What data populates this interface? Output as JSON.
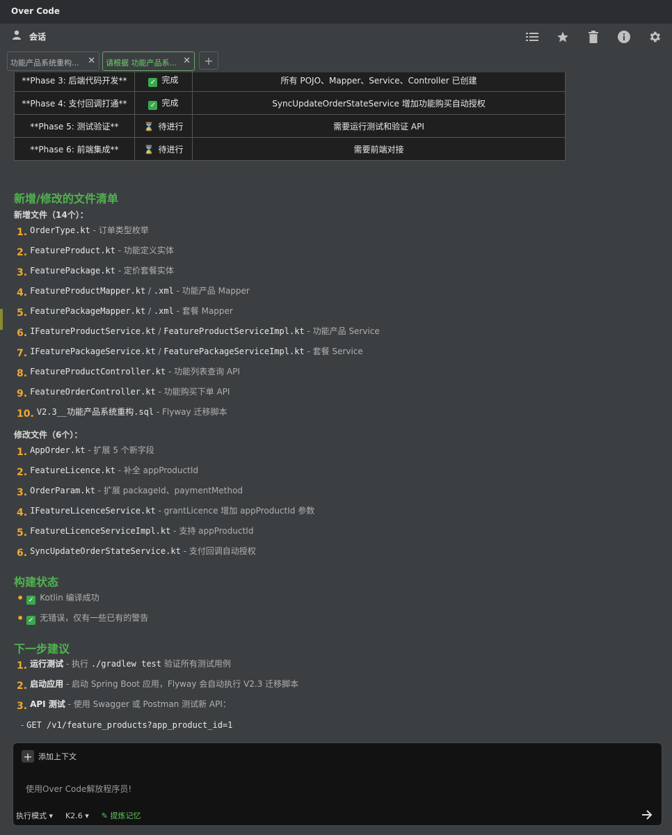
{
  "app": {
    "title": "Over Code"
  },
  "session": {
    "label": "会话"
  },
  "tabs": [
    {
      "label": "功能产品系统重构..."
    },
    {
      "label": "请根据 功能产品系..."
    }
  ],
  "phase_table": [
    {
      "phase": "**Phase 3: 后端代码开发**",
      "status": "完成",
      "status_icon": "check-icon",
      "note": "所有 POJO、Mapper、Service、Controller 已创建"
    },
    {
      "phase": "**Phase 4: 支付回调打通**",
      "status": "完成",
      "status_icon": "check-icon",
      "note": "SyncUpdateOrderStateService 增加功能购买自动授权"
    },
    {
      "phase": "**Phase 5: 测试验证**",
      "status": "待进行",
      "status_icon": "hourglass-icon",
      "note": "需要运行测试和验证 API"
    },
    {
      "phase": "**Phase 6: 前端集成**",
      "status": "待进行",
      "status_icon": "hourglass-icon",
      "note": "需要前端对接"
    }
  ],
  "files": {
    "heading": "新增/修改的文件清单",
    "new_heading": "新增文件（14个）：",
    "new_items": [
      {
        "num": "1.",
        "code": "OrderType.kt",
        "desc": " - 订单类型枚举"
      },
      {
        "num": "2.",
        "code": "FeatureProduct.kt",
        "desc": " - 功能定义实体"
      },
      {
        "num": "3.",
        "code": "FeaturePackage.kt",
        "desc": " - 定价套餐实体"
      },
      {
        "num": "4.",
        "code": "FeatureProductMapper.kt",
        "sep": " / ",
        "code2": ".xml",
        "desc": " - 功能产品 Mapper"
      },
      {
        "num": "5.",
        "code": "FeaturePackageMapper.kt",
        "sep": " / ",
        "code2": ".xml",
        "desc": " - 套餐 Mapper"
      },
      {
        "num": "6.",
        "code": "IFeatureProductService.kt",
        "sep": " / ",
        "code2": "FeatureProductServiceImpl.kt",
        "desc": " - 功能产品 Service"
      },
      {
        "num": "7.",
        "code": "IFeaturePackageService.kt",
        "sep": " / ",
        "code2": "FeaturePackageServiceImpl.kt",
        "desc": " - 套餐 Service"
      },
      {
        "num": "8.",
        "code": "FeatureProductController.kt",
        "desc": " - 功能列表查询 API"
      },
      {
        "num": "9.",
        "code": "FeatureOrderController.kt",
        "desc": " - 功能购买下单 API"
      },
      {
        "num": "10.",
        "code": "V2.3__功能产品系统重构.sql",
        "desc": " - Flyway 迁移脚本"
      }
    ],
    "mod_heading": "修改文件（6个）：",
    "mod_items": [
      {
        "num": "1.",
        "code": "AppOrder.kt",
        "desc": " - 扩展 5 个新字段"
      },
      {
        "num": "2.",
        "code": "FeatureLicence.kt",
        "desc": " - 补全 appProductId"
      },
      {
        "num": "3.",
        "code": "OrderParam.kt",
        "desc": " - 扩展 packageId、paymentMethod"
      },
      {
        "num": "4.",
        "code": "IFeatureLicenceService.kt",
        "desc": " - grantLicence 增加 appProductId 参数"
      },
      {
        "num": "5.",
        "code": "FeatureLicenceServiceImpl.kt",
        "desc": " - 支持 appProductId"
      },
      {
        "num": "6.",
        "code": "SyncUpdateOrderStateService.kt",
        "desc": " - 支付回调自动授权"
      }
    ]
  },
  "build": {
    "heading": "构建状态",
    "items": [
      {
        "bullet": "•",
        "text": "Kotlin 编译成功"
      },
      {
        "bullet": "•",
        "text": "无错误，仅有一些已有的警告"
      }
    ]
  },
  "next": {
    "heading": "下一步建议",
    "items": [
      {
        "num": "1.",
        "bold": "运行测试",
        "desc": " - 执行 ",
        "code": "./gradlew test",
        "desc2": " 验证所有测试用例"
      },
      {
        "num": "2.",
        "bold": "启动应用",
        "desc": " - 启动 Spring Boot 应用，Flyway 会自动执行 V2.3 迁移脚本"
      },
      {
        "num": "3.",
        "bold": "API 测试",
        "desc": " - 使用 Swagger 或 Postman 测试新 API："
      }
    ],
    "cmd_prefix": "- ",
    "cmd": "GET /v1/feature_products?app_product_id=1"
  },
  "input": {
    "add_context": "添加上下文",
    "placeholder": "使用Over Code解放程序员!",
    "mode": "执行模式",
    "model": "K2.6",
    "memory": "提炼记忆"
  },
  "colors": {
    "accent_green": "#4fb34f",
    "number_orange": "#f0a830",
    "table_bg": "#1f1f1f"
  }
}
